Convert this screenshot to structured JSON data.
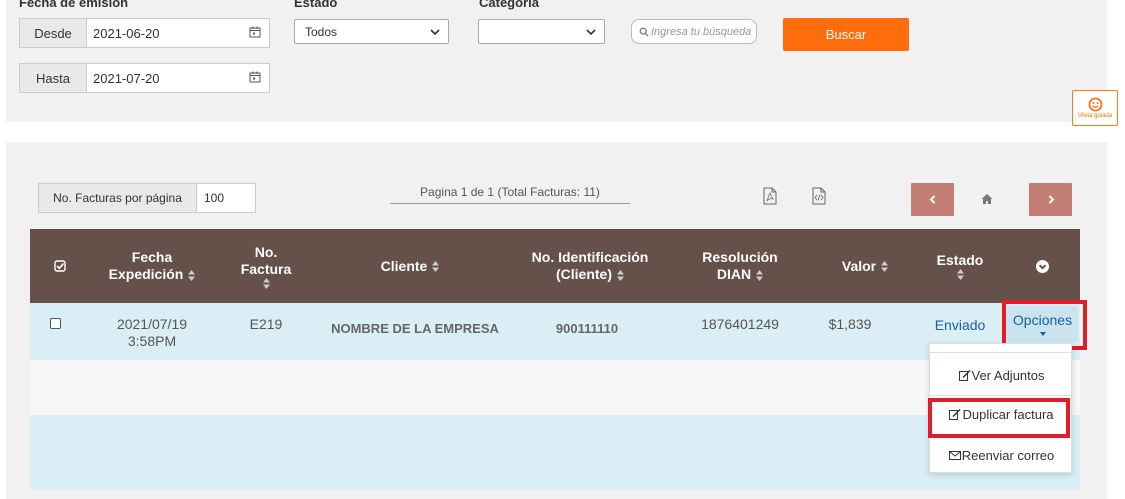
{
  "filters": {
    "fecha_label": "Fecha de emisión",
    "estado_label": "Estado",
    "categoria_label": "Categoria",
    "desde_label": "Desde",
    "desde_value": "2021-06-20",
    "hasta_label": "Hasta",
    "hasta_value": "2021-07-20",
    "estado_value": "Todos",
    "categoria_value": "",
    "search_placeholder": "Ingresa tu búsqueda",
    "buscar_label": "Buscar"
  },
  "visita_label": "Visita guiada",
  "list": {
    "perpage_label": "No. Facturas por página",
    "perpage_value": "100",
    "page_info": "Pagina 1 de 1 (Total Facturas: 11)"
  },
  "table": {
    "headers": {
      "fecha_1": "Fecha",
      "fecha_2": "Expedición",
      "nofact_1": "No.",
      "nofact_2": "Factura",
      "cliente": "Cliente",
      "noid_1": "No. Identificación",
      "noid_2": "(Cliente)",
      "resol_1": "Resolución",
      "resol_2": "DIAN",
      "valor": "Valor",
      "estado": "Estado"
    },
    "row": {
      "fecha_1": "2021/07/19",
      "fecha_2": "3:58PM",
      "factura": "E219",
      "cliente": "NOMBRE DE LA EMPRESA",
      "identificacion": "900111110",
      "resolucion": "1876401249",
      "valor": "$1,839",
      "estado": "Enviado",
      "opciones": "Opciones"
    }
  },
  "dropdown": {
    "ver_adjuntos": "Ver Adjuntos",
    "duplicar": "Duplicar factura",
    "reenviar": "Reenviar correo"
  },
  "colors": {
    "accent_orange": "#ff6d0d",
    "header_brown": "#65504a",
    "pager_button": "#c27e74",
    "row_blue": "#d9eef5",
    "highlight_red": "#e01e27",
    "link_blue": "#1b5fa3"
  }
}
